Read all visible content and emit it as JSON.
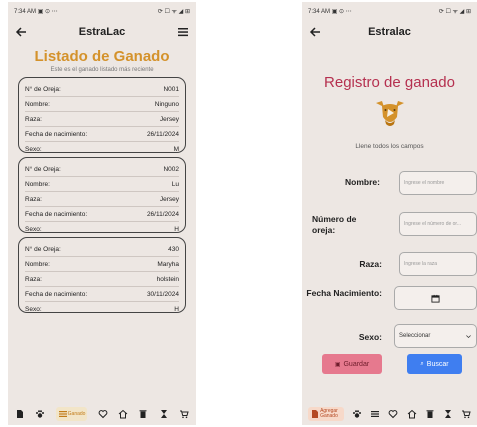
{
  "list_screen": {
    "status": {
      "time": "7:34 AM",
      "left_icons": "▣ ⊙ ⋯",
      "right_icons": "⟳ ☐ ᯤ ◢ ⊞"
    },
    "appbar": {
      "title": "EstraLac"
    },
    "heading": "Listado de Ganado",
    "subheading": "Este es el ganado listado más reciente",
    "cards": [
      {
        "fields": [
          {
            "label": "N° de Oreja:",
            "value": "N001"
          },
          {
            "label": "Nombre:",
            "value": "Ninguno"
          },
          {
            "label": "Raza:",
            "value": "Jersey"
          },
          {
            "label": "Fecha de nacimiento:",
            "value": "26/11/2024"
          },
          {
            "label": "Sexo:",
            "value": "M"
          }
        ]
      },
      {
        "fields": [
          {
            "label": "N° de Oreja:",
            "value": "N002"
          },
          {
            "label": "Nombre:",
            "value": "Lu"
          },
          {
            "label": "Raza:",
            "value": "Jersey"
          },
          {
            "label": "Fecha de nacimiento:",
            "value": "26/11/2024"
          },
          {
            "label": "Sexo:",
            "value": "H"
          }
        ]
      },
      {
        "fields": [
          {
            "label": "N° de Oreja:",
            "value": "430"
          },
          {
            "label": "Nombre:",
            "value": "Maryha"
          },
          {
            "label": "Raza:",
            "value": "holstein"
          },
          {
            "label": "Fecha de nacimiento:",
            "value": "30/11/2024"
          },
          {
            "label": "Sexo:",
            "value": "H"
          }
        ]
      }
    ],
    "nav_active_label": "Ganado"
  },
  "form_screen": {
    "status": {
      "time": "7:34 AM",
      "left_icons": "▣ ⊙ ⋯",
      "right_icons": "⟳ ☐ ᯤ ◢ ⊞"
    },
    "appbar": {
      "title": "Estralac"
    },
    "heading": "Registro de ganado",
    "instructions": "Llene todos los campos",
    "fields": {
      "nombre": {
        "label": "Nombre:",
        "placeholder": "Ingrese el nombre"
      },
      "oreja": {
        "label": "Número de oreja:",
        "placeholder": "Ingrese el número de or..."
      },
      "raza": {
        "label": "Raza:",
        "placeholder": "Ingrese la raza"
      },
      "fecha": {
        "label": "Fecha Nacimiento:"
      },
      "sexo": {
        "label": "Sexo:",
        "selected": "Seleccionar"
      }
    },
    "buttons": {
      "guardar": "Guardar",
      "buscar": "Buscar"
    },
    "nav_active_label": "Agregar Ganado"
  },
  "colors": {
    "heading_orange": "#d4922b",
    "heading_red": "#b5304f",
    "guardar_bg": "#e6798e",
    "buscar_bg": "#3f7ef0"
  }
}
